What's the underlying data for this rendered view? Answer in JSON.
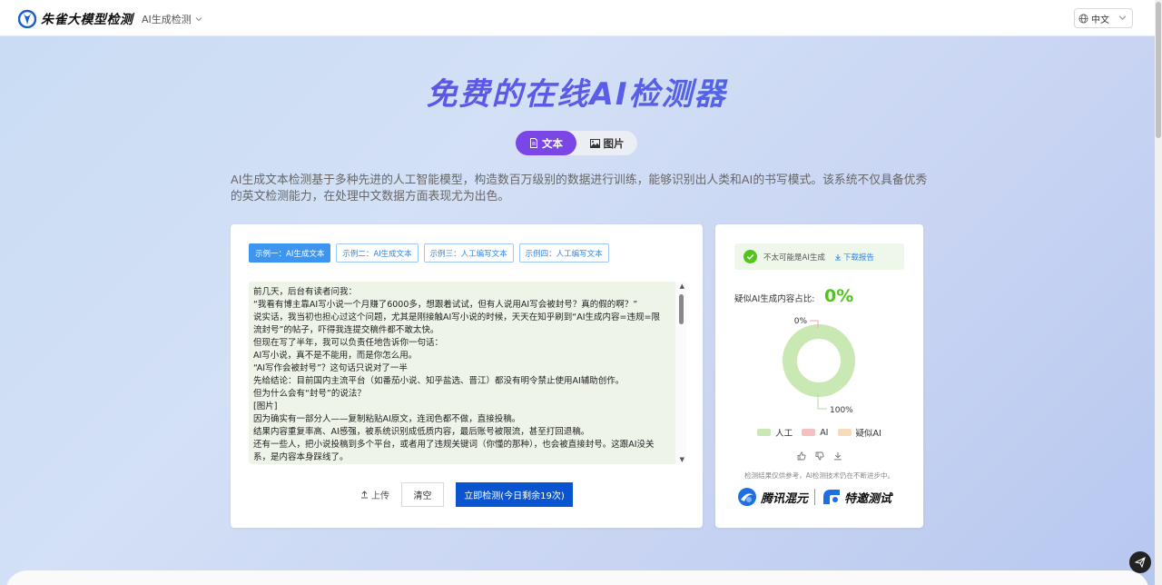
{
  "header": {
    "logo_text": "朱雀大模型检测",
    "nav_menu_label": "AI生成检测",
    "language": "中文"
  },
  "hero": {
    "title": "免费的在线AI检测器",
    "tabs": [
      {
        "label": "文本",
        "icon": "document-icon",
        "active": true
      },
      {
        "label": "图片",
        "icon": "image-icon",
        "active": false
      }
    ],
    "description": "AI生成文本检测基于多种先进的人工智能模型，构造数百万级别的数据进行训练，能够识别出人类和AI的书写模式。该系统不仅具备优秀的英文检测能力，在处理中文数据方面表现尤为出色。"
  },
  "editor": {
    "examples": [
      {
        "label": "示例一：AI生成文本",
        "active": true
      },
      {
        "label": "示例二：AI生成文本",
        "active": false
      },
      {
        "label": "示例三：人工编写文本",
        "active": false
      },
      {
        "label": "示例四：人工编写文本",
        "active": false
      }
    ],
    "text_lines": [
      "前几天，后台有读者问我：",
      "“我看有博主靠AI写小说一个月赚了6000多，想跟着试试，但有人说用AI写会被封号？真的假的啊？”",
      "说实话，我当初也担心过这个问题，尤其是刚接触AI写小说的时候，天天在知乎刷到“AI生成内容=违规=限流封号”的帖子，吓得我连提交稿件都不敢太快。",
      "但现在写了半年，我可以负责任地告诉你一句话：",
      "AI写小说，真不是不能用，而是你怎么用。",
      "“AI写作会被封号”？这句话只说对了一半",
      "先给结论：目前国内主流平台（如番茄小说、知乎盐选、晋江）都没有明令禁止使用AI辅助创作。",
      "但为什么会有“封号”的说法？",
      "[图片]",
      "因为确实有一部分人——复制粘贴AI原文，连润色都不做，直接投稿。",
      "结果内容重复率高、AI感强，被系统识别成低质内容，最后账号被限流，甚至打回退稿。",
      "还有一些人，把小说投稿到多个平台，或者用了违规关键词（你懂的那种），也会被直接封号。这跟AI没关系，是内容本身踩线了。"
    ],
    "upload_label": "上传",
    "clear_label": "清空",
    "detect_label": "立即检测(今日剩余19次)"
  },
  "result": {
    "verdict": "不太可能是AI生成",
    "download_label": "下载报告",
    "ratio_label": "疑似AI生成内容占比:",
    "ratio_value": "0%",
    "chart_data": {
      "type": "pie",
      "categories": [
        "人工",
        "AI",
        "疑似AI"
      ],
      "values": [
        100,
        0,
        0
      ],
      "data_labels": [
        "100%",
        "0%"
      ],
      "colors": [
        "#c9e8b4",
        "#f7c0c0",
        "#f8dcb8"
      ]
    },
    "legend": [
      {
        "label": "人工",
        "color": "#c9e8b4"
      },
      {
        "label": "AI",
        "color": "#f7c0c0"
      },
      {
        "label": "疑似AI",
        "color": "#f8dcb8"
      }
    ],
    "disclaimer": "检测结果仅供参考，AI检测技术仍在不断进步中。",
    "partners": [
      "腾讯混元",
      "特邀测试"
    ]
  }
}
